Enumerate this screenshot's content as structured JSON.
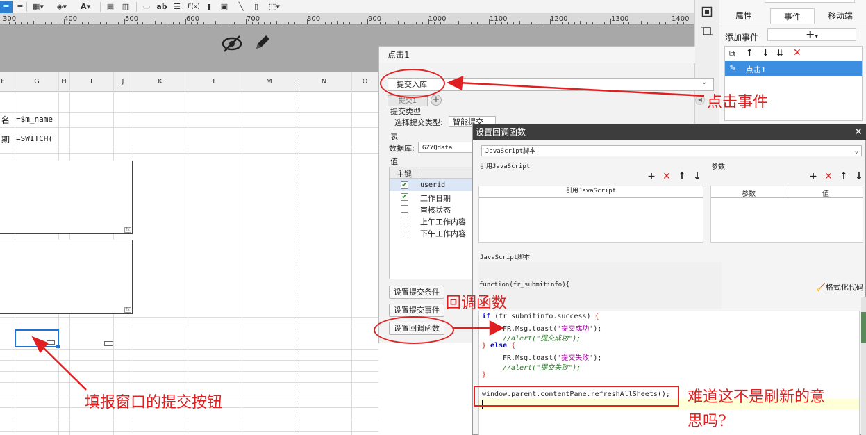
{
  "toolbar": {
    "icons": [
      "align-left-icon",
      "align-right-icon",
      "border-icon",
      "fill-icon",
      "font-color-icon",
      "table-icon",
      "table-2-icon",
      "textbox-icon",
      "ab-icon",
      "paragraph-icon",
      "formula-icon",
      "chart-icon",
      "image-icon",
      "slash-icon",
      "file-icon",
      "frame-icon"
    ],
    "ab_label": "ab",
    "formula_label": "F(x)",
    "font_color_label": "A"
  },
  "ruler": {
    "labels": [
      "300",
      "400",
      "500",
      "600",
      "700",
      "800",
      "900",
      "1000",
      "1100",
      "1200",
      "1300",
      "1400"
    ]
  },
  "sheet": {
    "columns": [
      "F",
      "G",
      "H",
      "I",
      "J",
      "K",
      "L",
      "M",
      "N",
      "O"
    ],
    "rows": [
      {
        "label": "名",
        "formula": "=$m_name"
      },
      {
        "label": "期",
        "formula": "=SWITCH("
      }
    ],
    "fx_label": "fx"
  },
  "right_panel": {
    "tabs": [
      "属性",
      "事件",
      "移动端"
    ],
    "add_event_label": "添加事件",
    "add_plus": "+",
    "event_item": "点击1"
  },
  "event_dialog": {
    "title": "点击1",
    "action_type": "提交入库",
    "sub_tab": "提交1",
    "submit_type_label": "提交类型",
    "choose_submit_label": "选择提交类型:",
    "choose_submit_value": "智能提交",
    "table_label": "表",
    "db_label": "数据库:",
    "db_value": "GZYQdata",
    "value_label": "值",
    "pk_header": "主键",
    "rows": [
      {
        "name": "userid",
        "checked": true
      },
      {
        "name": "工作日期",
        "checked": true
      },
      {
        "name": "审核状态",
        "checked": false
      },
      {
        "name": "上午工作内容",
        "checked": false
      },
      {
        "name": "下午工作内容",
        "checked": false
      }
    ],
    "buttons": [
      "设置提交条件",
      "设置提交事件",
      "设置回调函数"
    ]
  },
  "callback_dialog": {
    "title": "设置回调函数",
    "close_glyph": "✕",
    "script_type": "JavaScript脚本",
    "ref_js_label": "引用JavaScript",
    "ref_js_header": "引用JavaScript",
    "params_label": "参数",
    "params_header_1": "参数",
    "params_header_2": "值",
    "js_script_label": "JavaScript脚本",
    "func_sig": "function(fr_submitinfo){",
    "format_code": "格式化代码",
    "code": {
      "l1_kw": "if",
      "l1_rest": " (fr_submitinfo.success) ",
      "l1_brace": "{",
      "l2_fn": "FR.Msg.toast(",
      "l2_str": "'提交成功'",
      "l2_end": ");",
      "l3_cmt": "//alert(\"提交成功\");",
      "l4_brace": "}",
      "l4_kw": " else ",
      "l4_brace2": "{",
      "l5_fn": "FR.Msg.toast(",
      "l5_str": "'提交失败'",
      "l5_end": ");",
      "l6_cmt": "//alert(\"提交失败\");",
      "l7_brace": "}",
      "l8": "window.parent.contentPane.refreshAllSheets();"
    }
  },
  "annotations": {
    "click_event": "点击事件",
    "callback_fn": "回调函数",
    "submit_button": "填报窗口的提交按钮",
    "question_1": "难道这不是刷新的意",
    "question_2": "思吗?"
  },
  "colors": {
    "accent": "#2d7fd1",
    "annotation": "#e02020",
    "dialog_title": "#3d3d3d"
  }
}
